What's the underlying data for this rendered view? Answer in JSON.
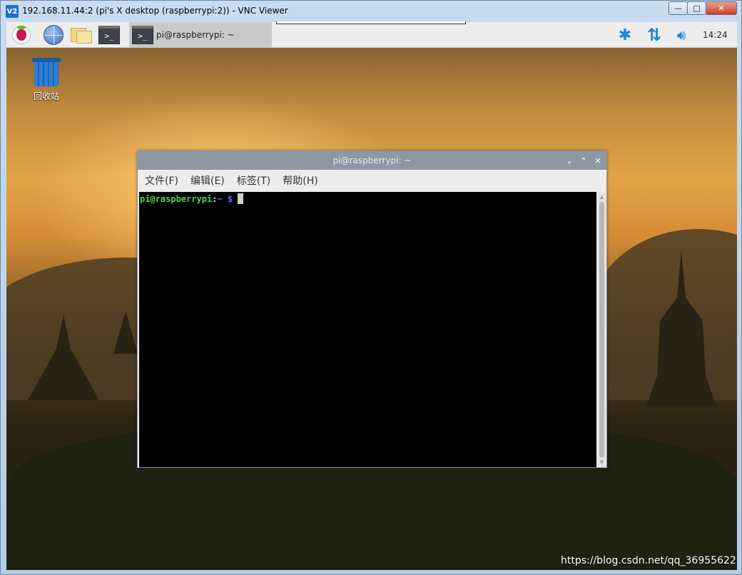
{
  "vnc_window": {
    "logo_text": "V2",
    "title": "192.168.11.44:2 (pi's X desktop (raspberrypi:2)) - VNC Viewer",
    "buttons": {
      "minimize": "—",
      "maximize": "□",
      "close": "✕"
    }
  },
  "taskbar": {
    "launchers": [
      {
        "name": "raspberry-pi-menu",
        "icon": "raspberry-icon"
      },
      {
        "name": "web-browser",
        "icon": "globe-icon"
      },
      {
        "name": "file-manager",
        "icon": "folder-icon"
      },
      {
        "name": "terminal",
        "icon": "terminal-icon",
        "glyph": ">_"
      }
    ],
    "task_button": {
      "glyph": ">_",
      "label": "pi@raspberrypi: ~"
    },
    "tray": {
      "bluetooth": "bluetooth-icon",
      "network": "network-updown-icon",
      "volume": "volume-icon",
      "clock": "14:24"
    }
  },
  "desktop": {
    "icons": [
      {
        "label": "回收站",
        "icon": "trash-icon"
      }
    ]
  },
  "terminal": {
    "title": "pi@raspberrypi: ~",
    "controls": {
      "minimize": "⌄",
      "maximize": "⌃",
      "close": "✕"
    },
    "menu": [
      "文件(F)",
      "编辑(E)",
      "标签(T)",
      "帮助(H)"
    ],
    "prompt": {
      "user_host": "pi@raspberrypi",
      "sep": ":",
      "path": "~",
      "symbol": "$"
    }
  },
  "watermark": "https://blog.csdn.net/qq_36955622",
  "colors": {
    "accent_blue": "#1a86d8",
    "terminal_bg": "#000000",
    "prompt_user": "#4ed34e",
    "prompt_path": "#5c6cff",
    "titlebar_gray": "#8d98a3"
  }
}
